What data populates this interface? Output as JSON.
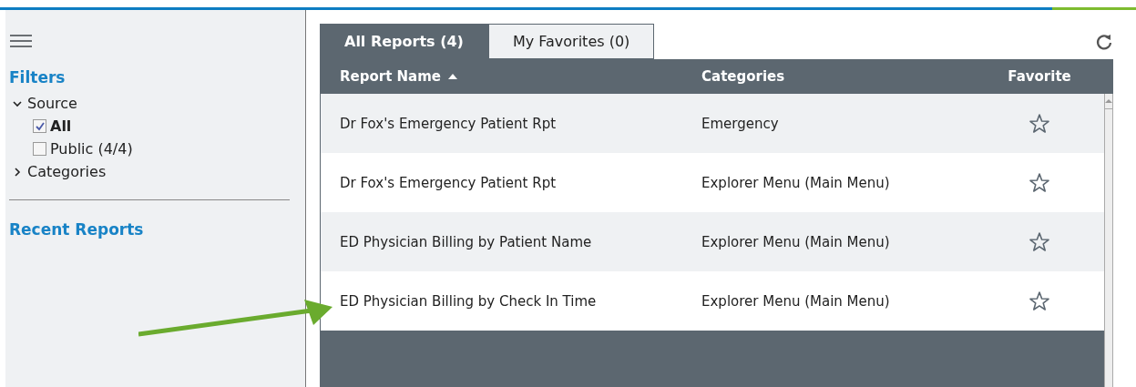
{
  "sidebar": {
    "filters_title": "Filters",
    "tree": [
      {
        "label": "Source",
        "expanded": true,
        "children": [
          {
            "label": "All",
            "checked": true
          },
          {
            "label": "Public (4/4)",
            "checked": false
          }
        ]
      },
      {
        "label": "Categories",
        "expanded": false
      }
    ],
    "recent_title": "Recent Reports"
  },
  "tabs": [
    {
      "label": "All Reports (4)",
      "selected": true
    },
    {
      "label": "My Favorites (0)",
      "selected": false
    }
  ],
  "table": {
    "columns": [
      "Report Name",
      "Categories",
      "Favorite"
    ],
    "rows": [
      {
        "name": "Dr Fox's Emergency Patient Rpt",
        "category": "Emergency",
        "favorite": false
      },
      {
        "name": "Dr Fox's Emergency Patient Rpt",
        "category": "Explorer Menu (Main Menu)",
        "favorite": false
      },
      {
        "name": "ED Physician Billing by Patient Name",
        "category": "Explorer Menu (Main Menu)",
        "favorite": false
      },
      {
        "name": "ED Physician Billing by Check In Time",
        "category": "Explorer Menu (Main Menu)",
        "favorite": false
      }
    ]
  }
}
